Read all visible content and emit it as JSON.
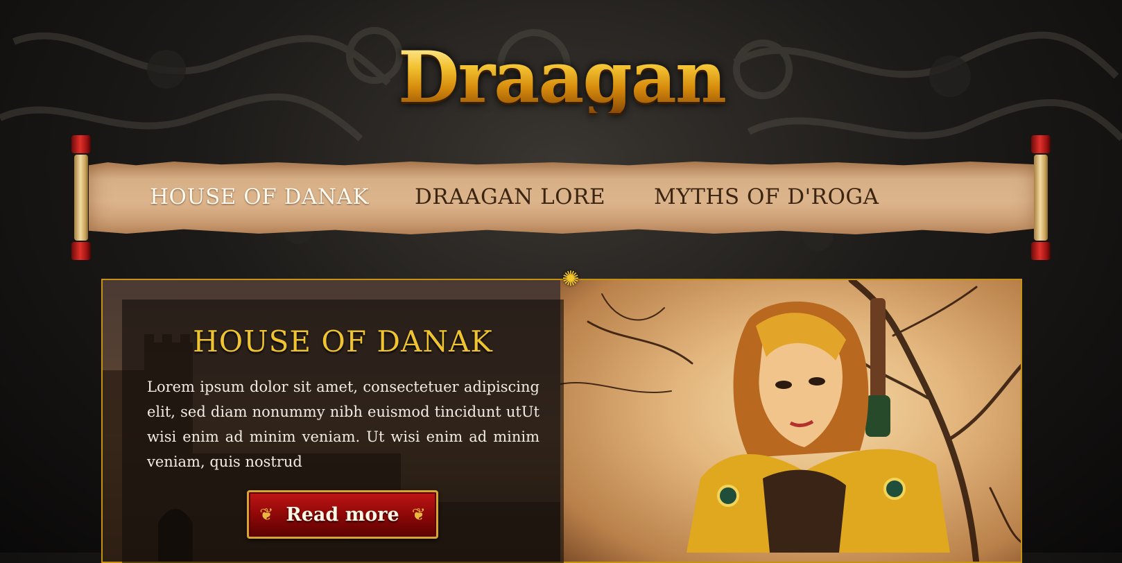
{
  "site": {
    "logo": "Draagan"
  },
  "nav": {
    "items": [
      {
        "label": "HOUSE OF DANAK",
        "active": true
      },
      {
        "label": "DRAAGAN LORE",
        "active": false
      },
      {
        "label": "MYTHS OF D'ROGA",
        "active": false
      }
    ]
  },
  "feature": {
    "heading": "HOUSE OF DANAK",
    "body": "Lorem ipsum dolor sit amet, consectetuer adipiscing elit, sed diam nonummy nibh euismod tincidunt utUt wisi enim ad minim veniam. Ut wisi enim ad minim veniam, quis nostrud",
    "button_label": "Read more"
  },
  "colors": {
    "gold": "#f0c431",
    "frame": "#c7920f",
    "button_red": "#a50d0d",
    "parchment": "#d8b189"
  },
  "icons": {
    "sun": "sun-ornament-icon",
    "flourish": "flourish-icon"
  }
}
